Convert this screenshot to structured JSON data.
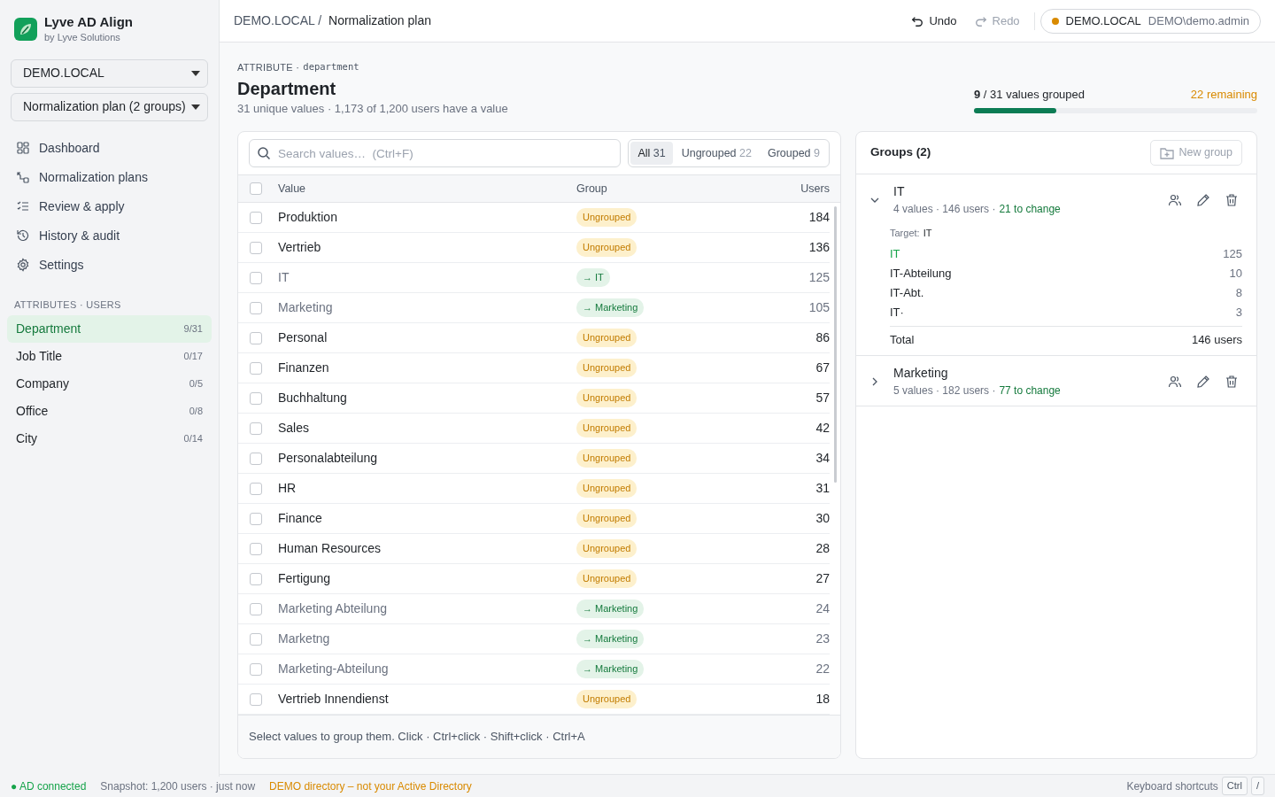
{
  "app": {
    "name": "Lyve AD Align",
    "subtitle": "by Lyve Solutions"
  },
  "sidebar": {
    "domain_select": "DEMO.LOCAL",
    "plan_select": "Normalization plan (2 groups)",
    "nav": [
      {
        "label": "Dashboard"
      },
      {
        "label": "Normalization plans"
      },
      {
        "label": "Review & apply"
      },
      {
        "label": "History & audit"
      },
      {
        "label": "Settings"
      }
    ],
    "section_label": "ATTRIBUTES · USERS",
    "attributes": [
      {
        "label": "Department",
        "count": "9/31",
        "selected": true
      },
      {
        "label": "Job Title",
        "count": "0/17",
        "selected": false
      },
      {
        "label": "Company",
        "count": "0/5",
        "selected": false
      },
      {
        "label": "Office",
        "count": "0/8",
        "selected": false
      },
      {
        "label": "City",
        "count": "0/14",
        "selected": false
      }
    ]
  },
  "topbar": {
    "breadcrumb_parent": "DEMO.LOCAL /",
    "breadcrumb_current": "Normalization plan",
    "undo": {
      "label": "Undo",
      "disabled": false
    },
    "redo": {
      "label": "Redo",
      "disabled": true
    },
    "connection": {
      "domain": "DEMO.LOCAL",
      "user": "DEMO\\demo.admin",
      "color": "#d98a00"
    }
  },
  "header": {
    "eyebrow": "ATTRIBUTE ·",
    "attribute_code": "department",
    "title": "Department",
    "summary": "31 unique values · 1,173 of 1,200 users have a value"
  },
  "progress": {
    "done": "9",
    "label": "/ 31 values grouped",
    "remaining": "22 remaining",
    "level": 0.29
  },
  "values_panel": {
    "search": {
      "placeholder": "Search values…  (Ctrl+F)"
    },
    "filters": [
      {
        "label": "All",
        "count": "31",
        "selected": true
      },
      {
        "label": "Ungrouped",
        "count": "22",
        "selected": false
      },
      {
        "label": "Grouped",
        "count": "9",
        "selected": false
      }
    ],
    "select_all_checked": false,
    "columns": [
      "Value",
      "Group",
      "Users"
    ],
    "rows": [
      {
        "value": "Produktion",
        "group": "Ungrouped",
        "grouped": false,
        "users": "184",
        "checked": false
      },
      {
        "value": "Vertrieb",
        "group": "Ungrouped",
        "grouped": false,
        "users": "136",
        "checked": false
      },
      {
        "value": "IT",
        "group": "→ IT",
        "grouped": true,
        "users": "125",
        "checked": false
      },
      {
        "value": "Marketing",
        "group": "→ Marketing",
        "grouped": true,
        "users": "105",
        "checked": false
      },
      {
        "value": "Personal",
        "group": "Ungrouped",
        "grouped": false,
        "users": "86",
        "checked": false
      },
      {
        "value": "Finanzen",
        "group": "Ungrouped",
        "grouped": false,
        "users": "67",
        "checked": false
      },
      {
        "value": "Buchhaltung",
        "group": "Ungrouped",
        "grouped": false,
        "users": "57",
        "checked": false
      },
      {
        "value": "Sales",
        "group": "Ungrouped",
        "grouped": false,
        "users": "42",
        "checked": false
      },
      {
        "value": "Personalabteilung",
        "group": "Ungrouped",
        "grouped": false,
        "users": "34",
        "checked": false
      },
      {
        "value": "HR",
        "group": "Ungrouped",
        "grouped": false,
        "users": "31",
        "checked": false
      },
      {
        "value": "Finance",
        "group": "Ungrouped",
        "grouped": false,
        "users": "30",
        "checked": false
      },
      {
        "value": "Human Resources",
        "group": "Ungrouped",
        "grouped": false,
        "users": "28",
        "checked": false
      },
      {
        "value": "Fertigung",
        "group": "Ungrouped",
        "grouped": false,
        "users": "27",
        "checked": false
      },
      {
        "value": "Marketing Abteilung",
        "group": "→ Marketing",
        "grouped": true,
        "users": "24",
        "checked": false
      },
      {
        "value": "Marketng",
        "group": "→ Marketing",
        "grouped": true,
        "users": "23",
        "checked": false
      },
      {
        "value": "Marketing-Abteilung",
        "group": "→ Marketing",
        "grouped": true,
        "users": "22",
        "checked": false
      },
      {
        "value": "Vertrieb Innendienst",
        "group": "Ungrouped",
        "grouped": false,
        "users": "18",
        "checked": false
      }
    ],
    "hint": "Select values to group them. Click · Ctrl+click · Shift+click · Ctrl+A"
  },
  "groups_panel": {
    "title": "Groups (2)",
    "new_group": {
      "label": "New group",
      "disabled": true
    },
    "groups": [
      {
        "name": "IT",
        "meta": "4 values · 146 users ·",
        "change": "21 to change",
        "expanded": true,
        "target_label": "Target:",
        "target": "IT",
        "values": [
          {
            "value": "IT",
            "count": "125",
            "is_target": true
          },
          {
            "value": "IT-Abteilung",
            "count": "10",
            "is_target": false
          },
          {
            "value": "IT-Abt.",
            "count": "8",
            "is_target": false
          },
          {
            "value": "IT·",
            "count": "3",
            "is_target": false
          }
        ],
        "total_label": "Total",
        "total": "146 users"
      },
      {
        "name": "Marketing",
        "meta": "5 values · 182 users ·",
        "change": "77 to change",
        "expanded": false
      }
    ]
  },
  "status_bar": {
    "connected": "● AD connected",
    "snapshot": "Snapshot: 1,200 users · just now",
    "notice": "DEMO directory – not your Active Directory",
    "shortcuts_label": "Keyboard shortcuts",
    "keys": [
      "Ctrl",
      "/"
    ]
  }
}
